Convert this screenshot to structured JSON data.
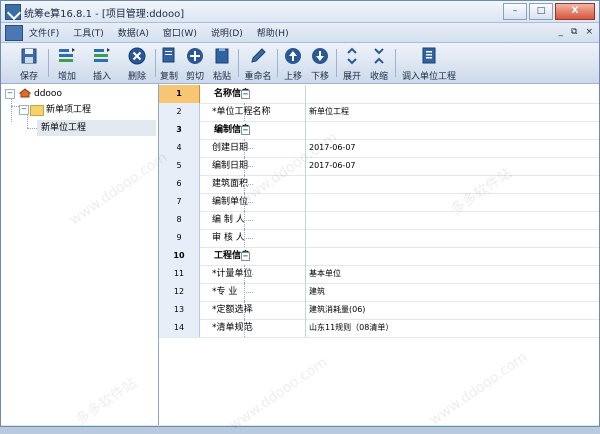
{
  "window": {
    "title": "统筹e算16.8.1 - [项目管理:ddooo]",
    "controls": [
      "–",
      "□",
      "X"
    ]
  },
  "menubar": {
    "items": [
      "文件(F)",
      "工具(T)",
      "数据(A)",
      "窗口(W)",
      "说明(D)",
      "帮助(H)"
    ],
    "mdi_controls": [
      "_",
      "⧉",
      "×"
    ]
  },
  "toolbar": {
    "buttons": [
      {
        "label": "保存",
        "icon": "save-icon"
      },
      {
        "label": "增加",
        "icon": "add-rows-icon"
      },
      {
        "label": "插入",
        "icon": "insert-rows-icon"
      },
      {
        "label": "删除",
        "icon": "delete-icon"
      },
      {
        "label": "复制",
        "icon": "copy-icon"
      },
      {
        "label": "剪切",
        "icon": "cut-icon"
      },
      {
        "label": "粘贴",
        "icon": "paste-icon"
      },
      {
        "label": "重命名",
        "icon": "rename-icon"
      },
      {
        "label": "上移",
        "icon": "move-up-icon"
      },
      {
        "label": "下移",
        "icon": "move-down-icon"
      },
      {
        "label": "展开",
        "icon": "expand-icon"
      },
      {
        "label": "收缩",
        "icon": "collapse-icon"
      },
      {
        "label": "调入单位工程",
        "icon": "import-icon"
      }
    ]
  },
  "tree": {
    "root": "ddooo",
    "items": [
      "新单项工程",
      "新单位工程"
    ]
  },
  "grid": {
    "rows": [
      {
        "num": "1",
        "name": "名称信息",
        "value": "",
        "type": "group"
      },
      {
        "num": "2",
        "name": "*单位工程名称",
        "value": "新单位工程",
        "type": "child"
      },
      {
        "num": "3",
        "name": "编制信息",
        "value": "",
        "type": "group"
      },
      {
        "num": "4",
        "name": "创建日期",
        "value": "2017-06-07",
        "type": "child"
      },
      {
        "num": "5",
        "name": "编制日期",
        "value": "2017-06-07",
        "type": "child"
      },
      {
        "num": "6",
        "name": "建筑面积",
        "value": "",
        "type": "child"
      },
      {
        "num": "7",
        "name": "编制单位",
        "value": "",
        "type": "child"
      },
      {
        "num": "8",
        "name": "编 制 人",
        "value": "",
        "type": "child"
      },
      {
        "num": "9",
        "name": "审 核 人",
        "value": "",
        "type": "child"
      },
      {
        "num": "10",
        "name": "工程信息",
        "value": "",
        "type": "group"
      },
      {
        "num": "11",
        "name": "*计量单位",
        "value": "基本单位",
        "type": "child"
      },
      {
        "num": "12",
        "name": "*专    业",
        "value": "建筑",
        "type": "child"
      },
      {
        "num": "13",
        "name": "*定额选择",
        "value": "建筑消耗量(06)",
        "type": "child"
      },
      {
        "num": "14",
        "name": "*清单规范",
        "value": "山东11规则（08清单）",
        "type": "child"
      }
    ]
  },
  "watermark": {
    "text": "多多软件站",
    "subtext": "www.ddooo.com"
  }
}
